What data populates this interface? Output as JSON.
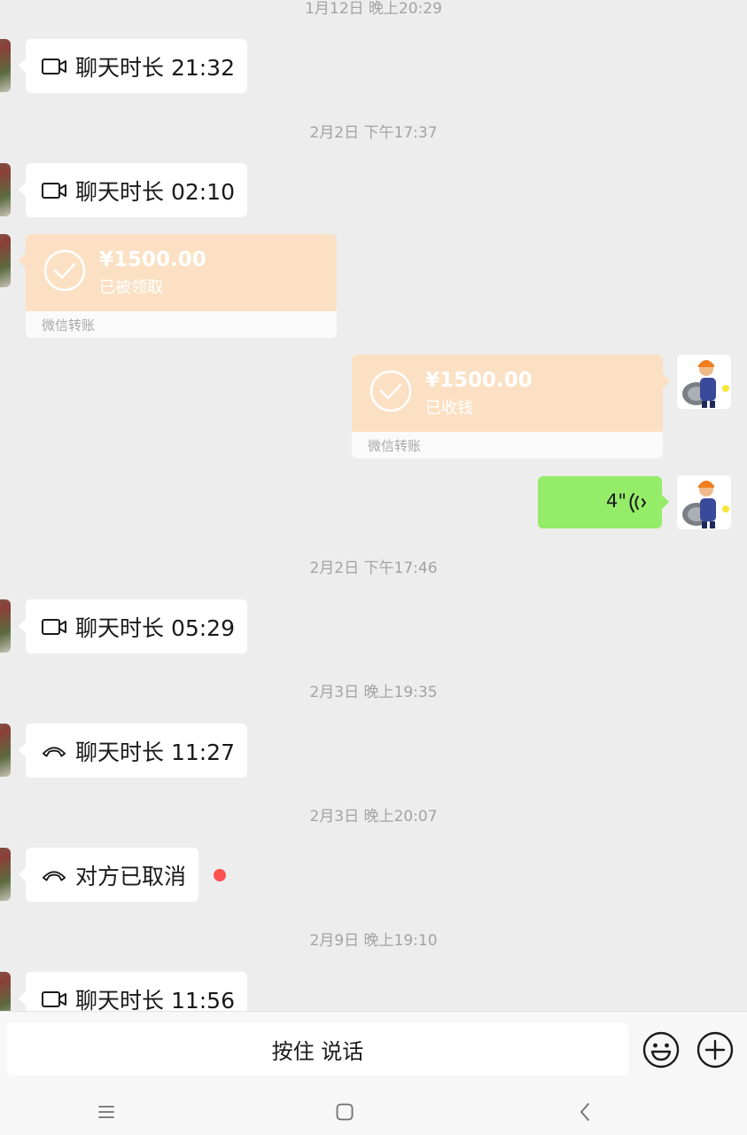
{
  "timestamps": [
    "1月12日 晚上20:29",
    "2月2日 下午17:37",
    "2月2日 下午17:46",
    "2月3日 晚上19:35",
    "2月3日 晚上20:07",
    "2月9日 晚上19:10"
  ],
  "calls": [
    {
      "type": "video",
      "text": "聊天时长 21:32"
    },
    {
      "type": "video",
      "text": "聊天时长 02:10"
    },
    {
      "type": "video",
      "text": "聊天时长 05:29"
    },
    {
      "type": "voice",
      "text": "聊天时长 11:27"
    },
    {
      "type": "voice",
      "text": "对方已取消"
    },
    {
      "type": "video",
      "text": "聊天时长 11:56"
    }
  ],
  "transfers": [
    {
      "amount": "¥1500.00",
      "status": "已被领取",
      "label": "微信转账"
    },
    {
      "amount": "¥1500.00",
      "status": "已收钱",
      "label": "微信转账"
    }
  ],
  "voice_message": {
    "duration": "4\""
  },
  "input": {
    "talk_label": "按住 说话"
  },
  "colors": {
    "background": "#ededed",
    "transfer": "#fbe0c3",
    "voice_bubble": "#95ec69",
    "unread_dot": "#fa5151"
  },
  "icons": {
    "video_call": "video-camera-icon",
    "voice_call": "phone-handset-icon",
    "transfer_done": "check-circle-icon",
    "emoji": "smiley-icon",
    "more": "plus-circle-icon"
  }
}
